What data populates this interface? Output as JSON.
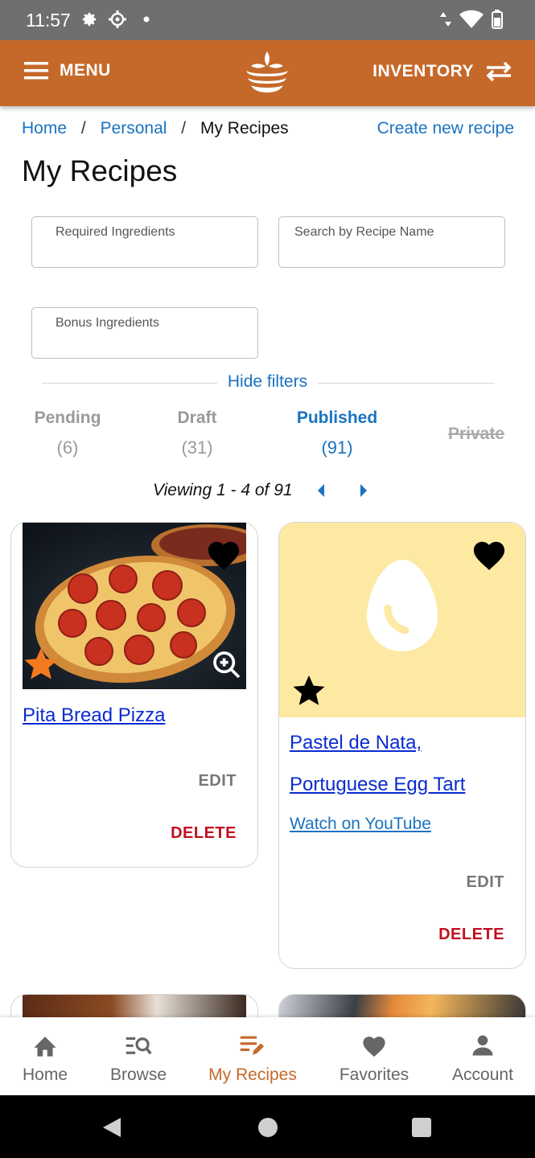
{
  "status_bar": {
    "time": "11:57",
    "icons_left": [
      "gear-icon",
      "settings-cog-icon",
      "dot-icon"
    ],
    "icons_right": [
      "data-arrows-icon",
      "wifi-icon",
      "battery-icon"
    ]
  },
  "app_bar": {
    "menu_label": "MENU",
    "inventory_label": "INVENTORY",
    "brand_color": "#c5692a"
  },
  "breadcrumb": {
    "items": [
      "Home",
      "Personal",
      "My Recipes"
    ],
    "separator": "/",
    "create_link": "Create new recipe"
  },
  "page_title": "My Recipes",
  "filters": {
    "required_ingredients_placeholder": "Required Ingredients",
    "search_name_placeholder": "Search by Recipe Name",
    "bonus_ingredients_placeholder": "Bonus Ingredients",
    "hide_filters_label": "Hide filters"
  },
  "status_tabs": [
    {
      "label": "Pending",
      "count": "(6)",
      "state": "inactive"
    },
    {
      "label": "Draft",
      "count": "(31)",
      "state": "inactive"
    },
    {
      "label": "Published",
      "count": "(91)",
      "state": "active"
    },
    {
      "label": "Private",
      "count": "",
      "state": "disabled"
    }
  ],
  "pagination": {
    "viewing_text": "Viewing 1 - 4 of 91"
  },
  "recipes": [
    {
      "title": "Pita Bread Pizza",
      "edit_label": "EDIT",
      "delete_label": "DELETE",
      "favorite": true,
      "starred": true,
      "star_color": "#f47a1f"
    },
    {
      "title_line1": "Pastel de Nata,",
      "title_line2": "Portuguese Egg Tart",
      "youtube_label": "Watch on YouTube",
      "edit_label": "EDIT",
      "delete_label": "DELETE",
      "favorite": true,
      "starred": true,
      "placeholder_bg": "#fde9a1"
    }
  ],
  "bottom_nav": [
    {
      "label": "Home",
      "icon": "home-icon",
      "active": false
    },
    {
      "label": "Browse",
      "icon": "browse-search-icon",
      "active": false
    },
    {
      "label": "My Recipes",
      "icon": "edit-list-icon",
      "active": true
    },
    {
      "label": "Favorites",
      "icon": "heart-icon",
      "active": false
    },
    {
      "label": "Account",
      "icon": "person-icon",
      "active": false
    }
  ]
}
